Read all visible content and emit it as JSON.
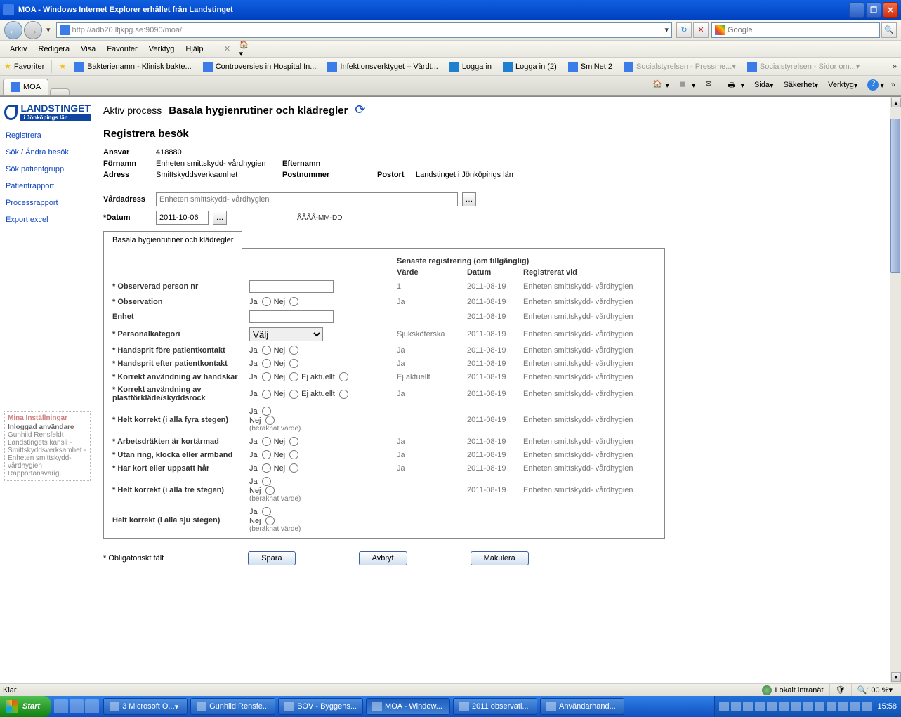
{
  "window": {
    "title": "MOA - Windows Internet Explorer erhållet från Landstinget"
  },
  "nav": {
    "url": "http://adb20.ltjkpg.se:9090/moa/",
    "search_placeholder": "Google"
  },
  "menu": {
    "arkiv": "Arkiv",
    "redigera": "Redigera",
    "visa": "Visa",
    "favoriter": "Favoriter",
    "verktyg": "Verktyg",
    "hjalp": "Hjälp"
  },
  "favbar": {
    "favoriter": "Favoriter",
    "items": [
      "Bakterienamn - Klinisk bakte...",
      "Controversies in Hospital In...",
      "Infektionsverktyget – Vårdt...",
      "Logga in",
      "Logga in (2)",
      "SmiNet 2",
      "Socialstyrelsen - Pressme...",
      "Socialstyrelsen - Sidor om..."
    ]
  },
  "tabs": {
    "active": "MOA"
  },
  "toolbar": {
    "sida": "Sida",
    "sakerhet": "Säkerhet",
    "verktyg": "Verktyg"
  },
  "logo": {
    "name": "LANDSTINGET",
    "sub": "i Jönköpings län"
  },
  "leftnav": {
    "registrera": "Registrera",
    "sok_besok": "Sök / Ändra besök",
    "sok_patient": "Sök patientgrupp",
    "patientrapport": "Patientrapport",
    "processrapport": "Processrapport",
    "export": "Export excel"
  },
  "settings": {
    "header": "Mina Inställningar",
    "user_lbl": "Inloggad användare",
    "user": "Gunhild Rensfeldt",
    "org1": "Landstingets kansli - Smittskyddsverksamhet -",
    "org2": "Enheten smittskydd-vårdhygien",
    "role": "Rapportansvarig"
  },
  "process": {
    "lbl": "Aktiv process",
    "val": "Basala hygienrutiner och klädregler"
  },
  "page_title": "Registrera besök",
  "info": {
    "ansvar_lbl": "Ansvar",
    "ansvar": "418880",
    "fornamn_lbl": "Förnamn",
    "fornamn": "Enheten smittskydd- vårdhygien",
    "efternamn_lbl": "Efternamn",
    "adress_lbl": "Adress",
    "adress": "Smittskyddsverksamhet",
    "postnr_lbl": "Postnummer",
    "postort_lbl": "Postort",
    "postort": "Landstinget i Jönköpings län"
  },
  "fields": {
    "vardadress_lbl": "Vårdadress",
    "vardadress_ph": "Enheten smittskydd- vårdhygien",
    "datum_lbl": "Datum",
    "datum_val": "2011-10-06",
    "datum_hint": "ÅÅÅÅ-MM-DD"
  },
  "formtab": "Basala hygienrutiner och klädregler",
  "cols": {
    "senaste": "Senaste registrering (om tillgänglig)",
    "varde": "Värde",
    "datum": "Datum",
    "reg": "Registrerat vid"
  },
  "opts": {
    "ja": "Ja",
    "nej": "Nej",
    "ej": "Ej aktuellt",
    "valj": "Välj",
    "beraknat": "(beräknat värde)"
  },
  "rows": {
    "r1": {
      "lbl": "Observerad person nr",
      "val": "1",
      "date": "2011-08-19",
      "reg": "Enheten smittskydd- vårdhygien"
    },
    "r2": {
      "lbl": "Observation",
      "val": "Ja",
      "date": "2011-08-19",
      "reg": "Enheten smittskydd- vårdhygien"
    },
    "r3": {
      "lbl": "Enhet",
      "val": "",
      "date": "2011-08-19",
      "reg": "Enheten smittskydd- vårdhygien"
    },
    "r4": {
      "lbl": "Personalkategori",
      "val": "Sjuksköterska",
      "date": "2011-08-19",
      "reg": "Enheten smittskydd- vårdhygien"
    },
    "r5": {
      "lbl": "Handsprit före patientkontakt",
      "val": "Ja",
      "date": "2011-08-19",
      "reg": "Enheten smittskydd- vårdhygien"
    },
    "r6": {
      "lbl": "Handsprit efter patientkontakt",
      "val": "Ja",
      "date": "2011-08-19",
      "reg": "Enheten smittskydd- vårdhygien"
    },
    "r7": {
      "lbl": "Korrekt användning av handskar",
      "val": "Ej aktuellt",
      "date": "2011-08-19",
      "reg": "Enheten smittskydd- vårdhygien"
    },
    "r8": {
      "lbl": "Korrekt användning av plastförkläde/skyddsrock",
      "val": "Ja",
      "date": "2011-08-19",
      "reg": "Enheten smittskydd- vårdhygien"
    },
    "r9": {
      "lbl": "Helt korrekt (i alla fyra stegen)",
      "val": "",
      "date": "2011-08-19",
      "reg": "Enheten smittskydd- vårdhygien"
    },
    "r10": {
      "lbl": "Arbetsdräkten är kortärmad",
      "val": "Ja",
      "date": "2011-08-19",
      "reg": "Enheten smittskydd- vårdhygien"
    },
    "r11": {
      "lbl": "Utan ring, klocka eller armband",
      "val": "Ja",
      "date": "2011-08-19",
      "reg": "Enheten smittskydd- vårdhygien"
    },
    "r12": {
      "lbl": "Har kort eller uppsatt hår",
      "val": "Ja",
      "date": "2011-08-19",
      "reg": "Enheten smittskydd- vårdhygien"
    },
    "r13": {
      "lbl": "Helt korrekt (i alla tre stegen)",
      "val": "",
      "date": "2011-08-19",
      "reg": "Enheten smittskydd- vårdhygien"
    },
    "r14": {
      "lbl": "Helt korrekt (i alla sju stegen)",
      "val": "",
      "date": "",
      "reg": ""
    }
  },
  "footer": {
    "oblig": "Obligatoriskt fält",
    "spara": "Spara",
    "avbryt": "Avbryt",
    "makulera": "Makulera"
  },
  "status": {
    "klar": "Klar",
    "zone": "Lokalt intranät",
    "zoom": "100 %"
  },
  "taskbar": {
    "start": "Start",
    "t1": "3 Microsoft O...",
    "t2": "Gunhild Rensfe...",
    "t3": "BOV - Byggens...",
    "t4": "MOA - Window...",
    "t5": "2011 observati...",
    "t6": "Användarhand...",
    "clock": "15:58"
  }
}
